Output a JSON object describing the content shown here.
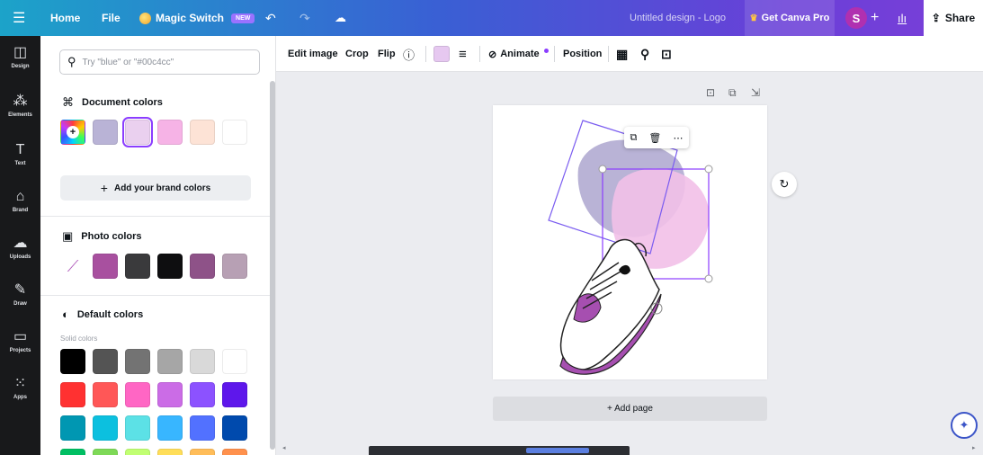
{
  "topbar": {
    "home": "Home",
    "file": "File",
    "magic_switch": "Magic Switch",
    "new_badge": "NEW",
    "doc_title": "Untitled design - Logo",
    "get_pro": "Get Canva Pro",
    "avatar_initial": "S",
    "share": "Share"
  },
  "rail": {
    "items": [
      {
        "label": "Design",
        "icon": "design-icon"
      },
      {
        "label": "Elements",
        "icon": "elements-icon"
      },
      {
        "label": "Text",
        "icon": "text-icon"
      },
      {
        "label": "Brand",
        "icon": "brand-icon"
      },
      {
        "label": "Uploads",
        "icon": "uploads-icon"
      },
      {
        "label": "Draw",
        "icon": "draw-icon"
      },
      {
        "label": "Projects",
        "icon": "projects-icon"
      },
      {
        "label": "Apps",
        "icon": "apps-icon"
      }
    ]
  },
  "panel": {
    "search_placeholder": "Try \"blue\" or \"#00c4cc\"",
    "document_colors_title": "Document colors",
    "document_colors": [
      "#b9b3d6",
      "#ead0ef",
      "#f6b3e6",
      "#fde3d6",
      "#ffffff"
    ],
    "add_brand_colors": "Add your brand colors",
    "photo_colors_title": "Photo colors",
    "photo_colors": [
      "#a8509f",
      "#3a3a3c",
      "#0e0e10",
      "#8e5288",
      "#b7a0b4"
    ],
    "default_colors_title": "Default colors",
    "solid_colors_label": "Solid colors",
    "default_rows": [
      [
        "#000000",
        "#545454",
        "#737373",
        "#a6a6a6",
        "#d9d9d9",
        "#ffffff"
      ],
      [
        "#ff3131",
        "#ff5757",
        "#ff66c4",
        "#cb6ce6",
        "#8c52ff",
        "#5e17eb"
      ],
      [
        "#0097b2",
        "#0cc0df",
        "#5ce1e6",
        "#38b6ff",
        "#5271ff",
        "#004aad"
      ],
      [
        "#00bf63",
        "#7ed957",
        "#c1ff72",
        "#ffde59",
        "#ffbd59",
        "#ff914d"
      ]
    ]
  },
  "toolbar": {
    "edit_image": "Edit image",
    "crop": "Crop",
    "flip": "Flip",
    "animate": "Animate",
    "position": "Position",
    "selected_color": "#e6c8f0"
  },
  "canvas": {
    "add_page": "+ Add page"
  }
}
